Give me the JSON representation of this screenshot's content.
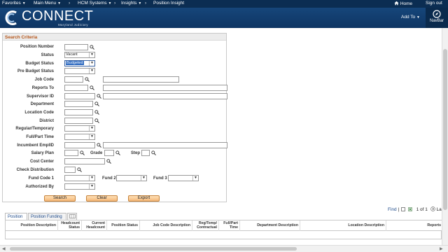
{
  "topnav": {
    "favorites": "Favorites",
    "main_menu": "Main Menu",
    "crumb1": "HCM Systems",
    "crumb2": "Insights",
    "crumb3": "Position Insight",
    "home": "Home",
    "signout": "Sign out"
  },
  "banner": {
    "logo_text": "CONNECT",
    "logo_sub": "Maryland Judiciary",
    "addto": "Add To",
    "navbar": "NavBar"
  },
  "criteria": {
    "header": "Search Criteria",
    "labels": {
      "position_number": "Position Number",
      "status": "Status",
      "budget_status": "Budget Status",
      "pre_budget_status": "Pre Budget Status",
      "job_code": "Job Code",
      "reports_to": "Reports To",
      "supervisor_id": "Supervisor ID",
      "department": "Department",
      "location_code": "Location Code",
      "district": "District",
      "regular_temporary": "Regular/Temporary",
      "full_part_time": "Full/Part Time",
      "incumbent_emplid": "Incumbent EmplID",
      "salary_plan": "Salary Plan",
      "grade": "Grade",
      "step": "Step",
      "cost_center": "Cost Center",
      "check_distribution": "Check Distribution",
      "fund_code_1": "Fund Code 1",
      "fund_2": "Fund 2",
      "fund_3": "Fund 3",
      "authorized_by": "Authorized By"
    },
    "values": {
      "status": "Vacant",
      "budget_status": "Budgeted"
    },
    "buttons": {
      "search": "Search",
      "clear": "Clear",
      "export": "Export"
    }
  },
  "results": {
    "tabs": [
      "Position",
      "Position Funding"
    ],
    "find": "Find",
    "pager": "1 of 1",
    "last": "La",
    "columns": [
      "Position Description",
      "Headcount Status",
      "Current Headcount",
      "Position Status",
      "Job Code Description",
      "Reg/Temp/ Contractual",
      "Full/Part Time",
      "Department Description",
      "Location Description",
      "Reports"
    ]
  },
  "colors": {
    "topbar": "#0b2d52",
    "banner": "#16467a",
    "section_title": "#b5561a",
    "button": "#f4b879"
  }
}
